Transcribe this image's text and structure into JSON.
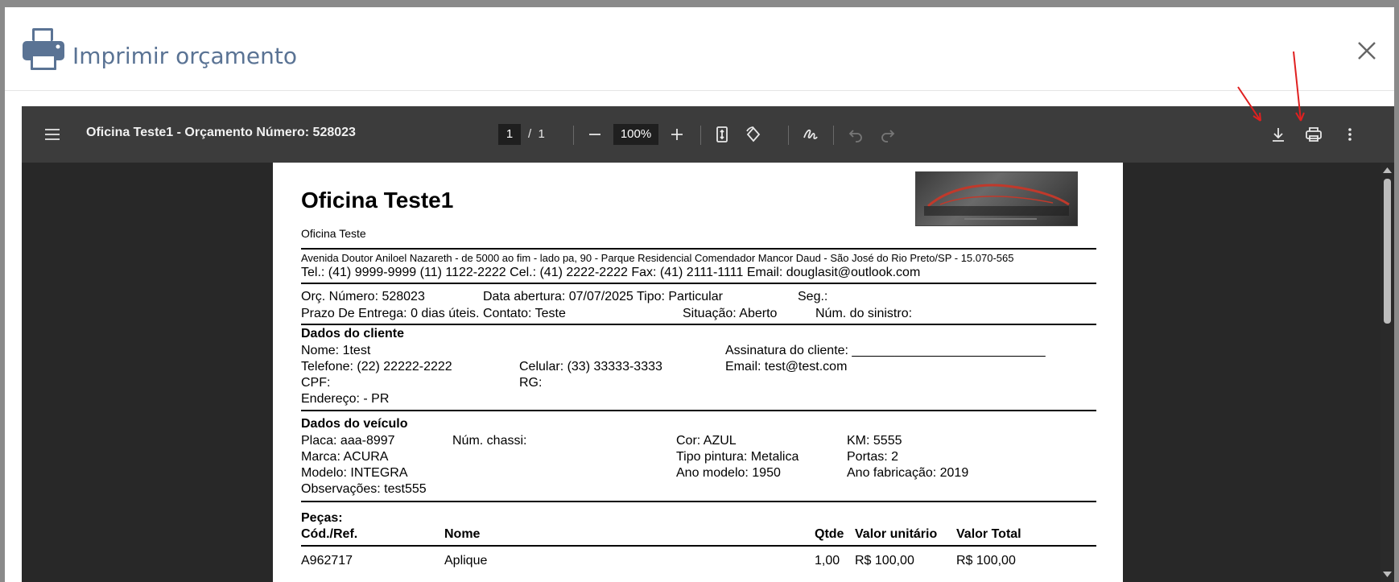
{
  "modal": {
    "title": "Imprimir orçamento"
  },
  "viewer": {
    "doc_title": "Oficina Teste1 - Orçamento Número: 528023",
    "page_current": "1",
    "page_sep": "/",
    "page_total": "1",
    "zoom": "100%"
  },
  "doc": {
    "company": "Oficina Teste1",
    "subtitle": "Oficina Teste",
    "address": "Avenida Doutor Aniloel Nazareth - de 5000 ao fim - lado pa, 90 - Parque Residencial Comendador Mancor Daud  - São José do Rio Preto/SP - 15.070-565",
    "phones": "Tel.: (41) 9999-9999 (11) 1122-2222 Cel.: (41) 2222-2222 Fax: (41) 2111-1111 Email: douglasit@outlook.com",
    "info": {
      "orc_numero": "Orç. Número: 528023",
      "data_abertura": "Data abertura: 07/07/2025 Tipo: Particular",
      "seg": "Seg.:",
      "prazo": "Prazo De Entrega: 0 dias úteis.",
      "contato": "Contato: Teste",
      "situacao": "Situação: Aberto",
      "sinistro": "Núm. do sinistro:"
    },
    "cliente": {
      "heading": "Dados do cliente",
      "nome": "Nome: 1test",
      "assinatura": "Assinatura do cliente: ___________________________",
      "telefone": "Telefone: (22) 22222-2222",
      "celular": "Celular: (33) 33333-3333",
      "email": "Email:  test@test.com",
      "cpf": "CPF:",
      "rg": "RG:",
      "endereco": "Endereço:  - PR"
    },
    "veiculo": {
      "heading": "Dados do veículo",
      "placa": "Placa: aaa-8997",
      "chassi": "Núm. chassi:",
      "cor": "Cor: AZUL",
      "km": "KM: 5555",
      "marca": "Marca: ACURA",
      "tipo_pintura": "Tipo pintura: Metalica",
      "portas": "Portas: 2",
      "modelo": "Modelo: INTEGRA",
      "ano_modelo": "Ano modelo: 1950",
      "ano_fabricacao": "Ano fabricação: 2019",
      "observacoes": "Observações: test555"
    },
    "pecas": {
      "heading": "Peças:",
      "columns": [
        "Cód./Ref.",
        "Nome",
        "Qtde",
        "Valor unitário",
        "Valor Total"
      ],
      "rows": [
        [
          "A962717",
          "Aplique",
          "1,00",
          "R$ 100,00",
          "R$ 100,00"
        ]
      ]
    }
  }
}
